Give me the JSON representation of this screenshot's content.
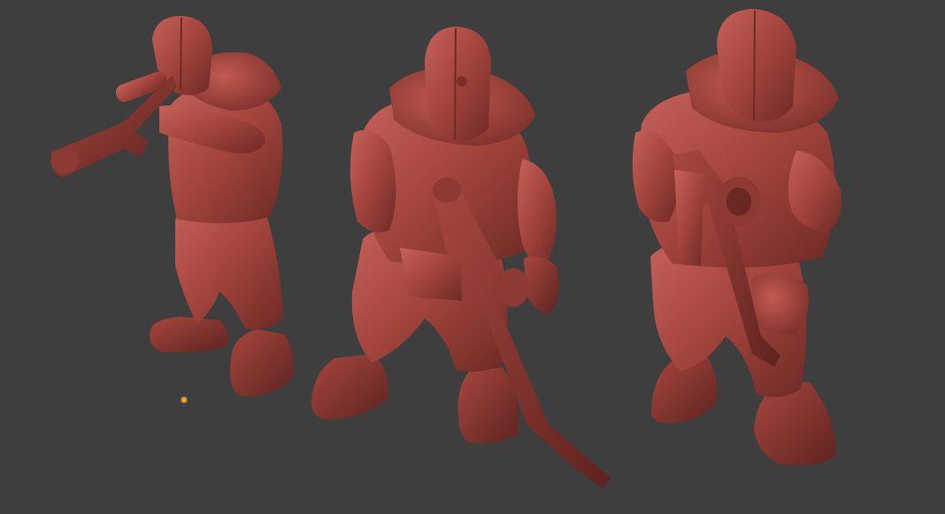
{
  "viewport": {
    "background": "#3e3e3e",
    "model_color": "#a2443c",
    "model_shade": "#7a2f29",
    "model_highlight": "#c4615a",
    "origin_marker_color": "#f5a623"
  },
  "models": [
    {
      "name": "trooper-aiming"
    },
    {
      "name": "trooper-holding-rifle"
    },
    {
      "name": "trooper-rifle-raised"
    }
  ]
}
